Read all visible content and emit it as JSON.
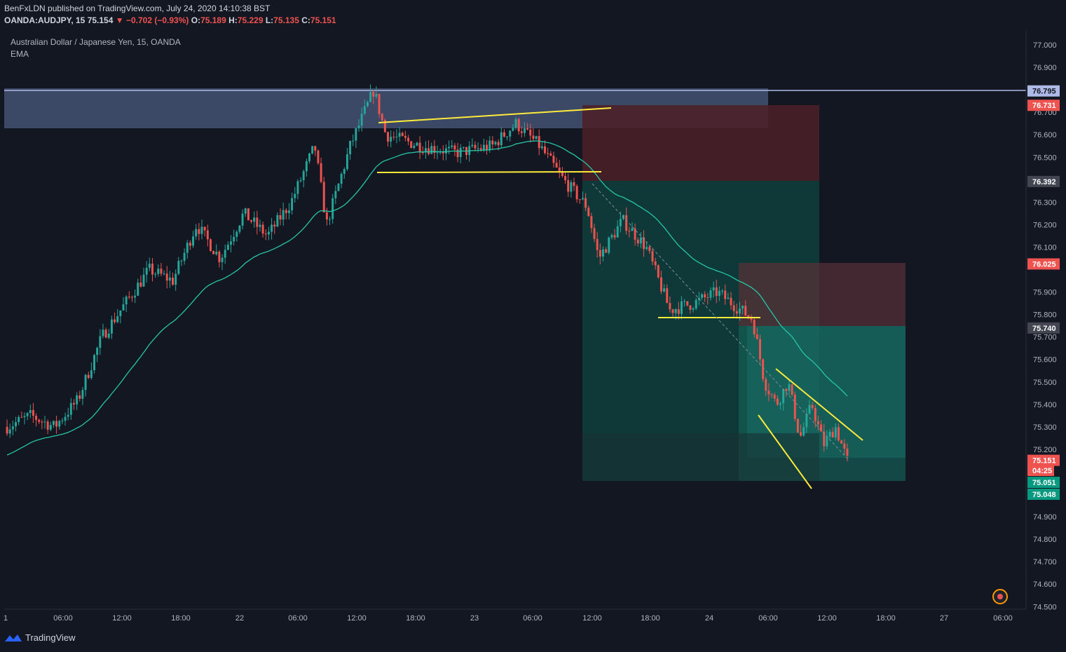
{
  "header": {
    "published": "BenFxLDN published on TradingView.com, July 24, 2020 14:10:38 BST",
    "symbol": "OANDA:AUDJPY, 15",
    "last": "75.154",
    "change": "−0.702 (−0.93%)",
    "o_label": "O:",
    "o_value": "75.189",
    "h_label": "H:",
    "h_value": "75.229",
    "l_label": "L:",
    "l_value": "75.135",
    "c_label": "C:",
    "c_value": "75.151"
  },
  "legend": {
    "title": "Australian Dollar / Japanese Yen, 15, OANDA",
    "indicator": "EMA"
  },
  "footer": {
    "brand": "TradingView"
  },
  "colors": {
    "background": "#131722",
    "up": "#26a69a",
    "down": "#ef5350",
    "ema": "#26c6a6",
    "trendline": "#ffeb3b",
    "zone": "#4a5a7e"
  },
  "chart_data": {
    "type": "candlestick",
    "symbol": "AUDJPY",
    "timeframe": "15",
    "y_ticks": [
      "77.000",
      "76.900",
      "76.700",
      "76.600",
      "76.500",
      "76.300",
      "76.200",
      "76.100",
      "75.900",
      "75.800",
      "75.700",
      "75.600",
      "75.500",
      "75.400",
      "75.300",
      "75.200",
      "74.900",
      "74.800",
      "74.700",
      "74.600",
      "74.500"
    ],
    "x_ticks": [
      "1",
      "06:00",
      "12:00",
      "18:00",
      "22",
      "06:00",
      "12:00",
      "18:00",
      "23",
      "06:00",
      "12:00",
      "18:00",
      "24",
      "06:00",
      "12:00",
      "18:00",
      "27",
      "06:00"
    ],
    "price_labels": [
      {
        "value": "76.795",
        "kind": "line"
      },
      {
        "value": "76.731",
        "kind": "stop"
      },
      {
        "value": "76.392",
        "kind": "entry"
      },
      {
        "value": "76.025",
        "kind": "stop"
      },
      {
        "value": "75.740",
        "kind": "entry"
      },
      {
        "value": "75.151",
        "kind": "last"
      },
      {
        "value": "04:25",
        "kind": "countdown"
      },
      {
        "value": "75.051",
        "kind": "target"
      },
      {
        "value": "75.048",
        "kind": "target"
      }
    ],
    "ylim": [
      74.48,
      77.08
    ],
    "time_range": [
      "Jul 21",
      "Jul 27 06:00"
    ],
    "close_path": [
      {
        "t": 0,
        "p": 75.3
      },
      {
        "t": 4,
        "p": 75.35
      },
      {
        "t": 8,
        "p": 75.3
      },
      {
        "t": 12,
        "p": 75.42
      },
      {
        "t": 16,
        "p": 75.7
      },
      {
        "t": 20,
        "p": 75.85
      },
      {
        "t": 24,
        "p": 76.0
      },
      {
        "t": 28,
        "p": 75.95
      },
      {
        "t": 32,
        "p": 76.2
      },
      {
        "t": 36,
        "p": 76.05
      },
      {
        "t": 40,
        "p": 76.25
      },
      {
        "t": 44,
        "p": 76.15
      },
      {
        "t": 48,
        "p": 76.3
      },
      {
        "t": 52,
        "p": 76.55
      },
      {
        "t": 54,
        "p": 76.2
      },
      {
        "t": 58,
        "p": 76.55
      },
      {
        "t": 62,
        "p": 76.8
      },
      {
        "t": 64,
        "p": 76.6
      },
      {
        "t": 70,
        "p": 76.55
      },
      {
        "t": 76,
        "p": 76.52
      },
      {
        "t": 82,
        "p": 76.55
      },
      {
        "t": 86,
        "p": 76.65
      },
      {
        "t": 90,
        "p": 76.55
      },
      {
        "t": 94,
        "p": 76.4
      },
      {
        "t": 98,
        "p": 76.28
      },
      {
        "t": 100,
        "p": 76.05
      },
      {
        "t": 104,
        "p": 76.22
      },
      {
        "t": 108,
        "p": 76.1
      },
      {
        "t": 112,
        "p": 75.82
      },
      {
        "t": 116,
        "p": 75.85
      },
      {
        "t": 120,
        "p": 75.9
      },
      {
        "t": 124,
        "p": 75.82
      },
      {
        "t": 126,
        "p": 75.78
      },
      {
        "t": 128,
        "p": 75.5
      },
      {
        "t": 130,
        "p": 75.4
      },
      {
        "t": 132,
        "p": 75.5
      },
      {
        "t": 134,
        "p": 75.25
      },
      {
        "t": 136,
        "p": 75.4
      },
      {
        "t": 138,
        "p": 75.22
      },
      {
        "t": 140,
        "p": 75.3
      },
      {
        "t": 142,
        "p": 75.15
      }
    ]
  }
}
